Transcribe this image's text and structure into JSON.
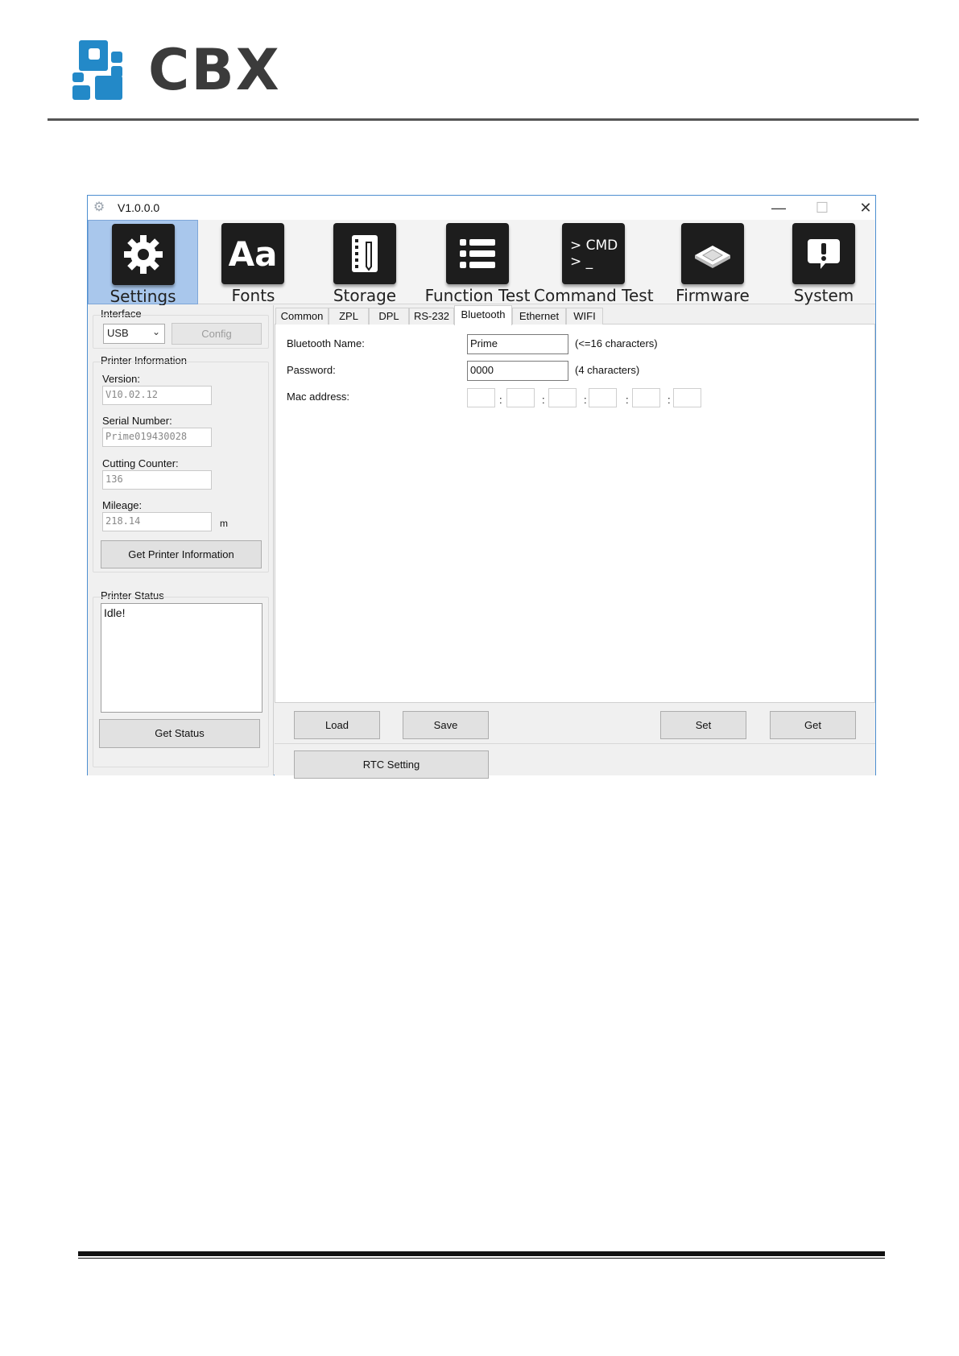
{
  "brand": {
    "name": "CBX",
    "color": "#2389c8"
  },
  "window": {
    "title": "V1.0.0.0",
    "minimize": "—",
    "maximize": "☐",
    "close": "✕"
  },
  "toolbar": {
    "items": [
      {
        "label": "Settings",
        "icon": "gear-icon",
        "active": true
      },
      {
        "label": "Fonts",
        "icon": "fonts-icon",
        "glyph": "Aa"
      },
      {
        "label": "Storage",
        "icon": "storage-icon"
      },
      {
        "label": "Function Test",
        "icon": "list-icon"
      },
      {
        "label": "Command Test",
        "icon": "cmd-icon",
        "glyph1": "> CMD",
        "glyph2": "> _"
      },
      {
        "label": "Firmware",
        "icon": "chip-icon"
      },
      {
        "label": "System",
        "icon": "alert-icon"
      }
    ]
  },
  "left": {
    "interface_label": "Interface",
    "interface_value": "USB",
    "config_label": "Config",
    "printer_info_label": "Printer Information",
    "version_label": "Version:",
    "version_value": "V10.02.12",
    "serial_label": "Serial Number:",
    "serial_value": "Prime019430028",
    "cutting_label": "Cutting Counter:",
    "cutting_value": "136",
    "mileage_label": "Mileage:",
    "mileage_value": "218.14",
    "mileage_unit": "m",
    "get_info_label": "Get Printer Information",
    "status_label": "Printer Status",
    "status_value": "Idle!",
    "get_status_label": "Get Status"
  },
  "tabs": [
    "Common",
    "ZPL",
    "DPL",
    "RS-232",
    "Bluetooth",
    "Ethernet",
    "WIFI"
  ],
  "active_tab": "Bluetooth",
  "bluetooth": {
    "name_label": "Bluetooth Name:",
    "name_value": "Prime",
    "name_hint": "(<=16 characters)",
    "password_label": "Password:",
    "password_value": "0000",
    "password_hint": "(4 characters)",
    "mac_label": "Mac address:",
    "mac_separator": ":"
  },
  "actions": {
    "load": "Load",
    "save": "Save",
    "set": "Set",
    "get": "Get",
    "rtc": "RTC Setting"
  }
}
